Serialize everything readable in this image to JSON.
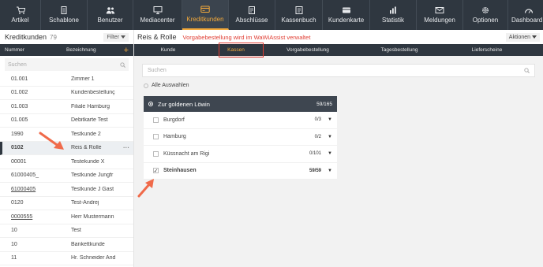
{
  "nav": [
    {
      "label": "Artikel",
      "icon": "cart-icon"
    },
    {
      "label": "Schablone",
      "icon": "document-icon"
    },
    {
      "label": "Benutzer",
      "icon": "users-icon"
    },
    {
      "label": "Mediacenter",
      "icon": "monitor-icon"
    },
    {
      "label": "Kreditkunden",
      "icon": "credit-card-icon",
      "active": true
    },
    {
      "label": "Abschlüsse",
      "icon": "folder-icon"
    },
    {
      "label": "Kassenbuch",
      "icon": "book-icon"
    },
    {
      "label": "Kundenkarte",
      "icon": "card-icon"
    },
    {
      "label": "Statistik",
      "icon": "bar-chart-icon"
    },
    {
      "label": "Meldungen",
      "icon": "mail-icon"
    },
    {
      "label": "Optionen",
      "icon": "gear-icon"
    },
    {
      "label": "Dashboard",
      "icon": "dashboard-icon"
    }
  ],
  "left": {
    "title": "Kreditkunden",
    "count": "79",
    "filter_label": "Filter",
    "col_number": "Nummer",
    "col_name": "Bezeichnung",
    "search_placeholder": "Suchen",
    "rows": [
      {
        "num": "01.001",
        "name": "Zimmer 1"
      },
      {
        "num": "01.002",
        "name": "Kundenbestellunç"
      },
      {
        "num": "01.003",
        "name": "Filiale Hamburg"
      },
      {
        "num": "01.005",
        "name": "Debitkarte Test"
      },
      {
        "num": "1990",
        "name": "Testkunde 2"
      },
      {
        "num": "0102",
        "name": "Reis & Rolle",
        "selected": true
      },
      {
        "num": "00001",
        "name": "Testekunde X"
      },
      {
        "num": "61000405_",
        "name": "Testkunde Jungfr"
      },
      {
        "num": "61000405",
        "name": "Testkunde J Gast",
        "underline": true
      },
      {
        "num": "0120",
        "name": "Test-Andrej"
      },
      {
        "num": "0000555",
        "name": "Herr Mustermann",
        "underline": true
      },
      {
        "num": "10",
        "name": "Test"
      },
      {
        "num": "10",
        "name": "Bankettkunde"
      },
      {
        "num": "11",
        "name": "Hr. Schneider And"
      }
    ]
  },
  "right": {
    "title": "Reis & Rolle",
    "warning": "Vorgabebestellung wird im WaWiAssist verwaltet",
    "aktionen_label": "Aktionen",
    "tabs": [
      "Kunde",
      "Kassen",
      "Vorgabebestellung",
      "Tagesbestellung",
      "Lieferscheine"
    ],
    "active_tab": "Kassen",
    "search_placeholder": "Suchen",
    "select_all": "Alle Auswahlen",
    "group": {
      "name": "Zur goldenen Löwin",
      "count": "59/165",
      "items": [
        {
          "name": "Burgdorf",
          "count": "0/3",
          "checked": false
        },
        {
          "name": "Hamburg",
          "count": "0/2",
          "checked": false
        },
        {
          "name": "Küssnacht am Rigi",
          "count": "0/101",
          "checked": false
        },
        {
          "name": "Steinhausen",
          "count": "59/59",
          "checked": true
        }
      ]
    }
  },
  "colors": {
    "nav_bg": "#2f3740",
    "accent": "#f2a93b",
    "warning": "#e03c31",
    "arrow": "#f06a4a"
  }
}
